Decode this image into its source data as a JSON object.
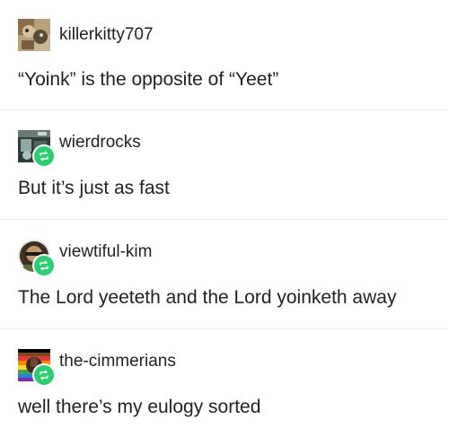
{
  "posts": [
    {
      "username": "killerkitty707",
      "text": "“Yoink” is the opposite of “Yeet”",
      "reblog": false
    },
    {
      "username": "wierdrocks",
      "text": "But it’s just as fast",
      "reblog": true
    },
    {
      "username": "viewtiful-kim",
      "text": "The Lord yeeteth and the Lord yoinketh away",
      "reblog": true
    },
    {
      "username": "the-cimmerians",
      "text": "well there’s my eulogy sorted",
      "reblog": true
    }
  ],
  "colors": {
    "reblog_badge": "#2ecc71",
    "divider": "#ececec",
    "text": "#222222"
  }
}
